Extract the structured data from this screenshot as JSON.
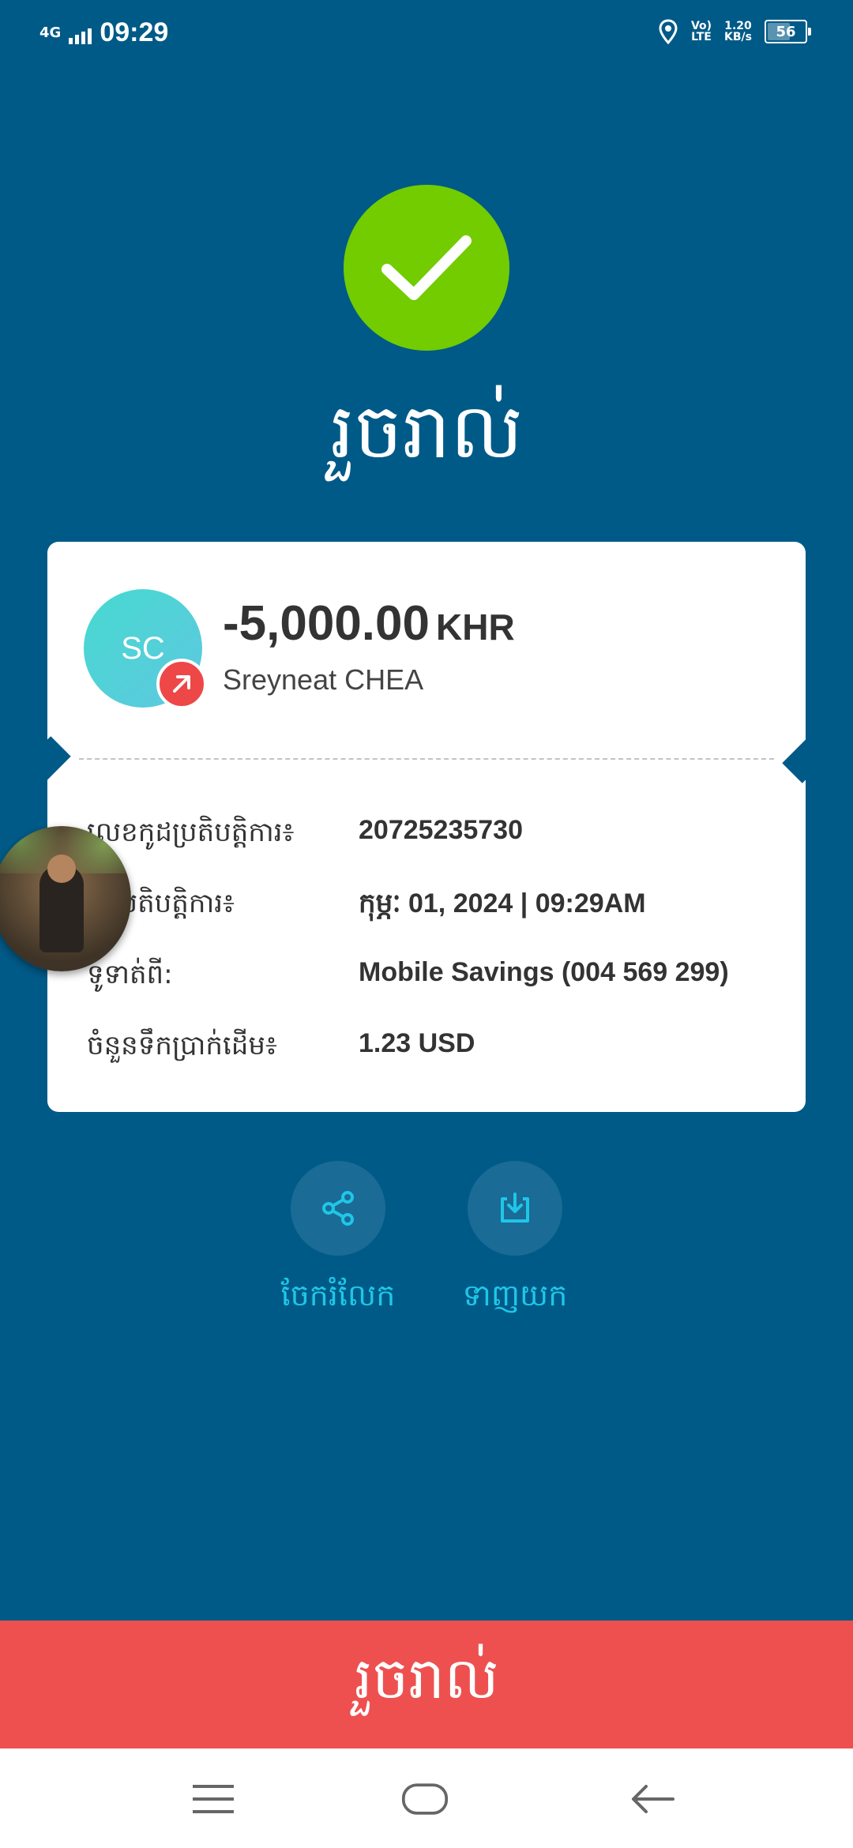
{
  "status_bar": {
    "network": "4G",
    "time": "09:29",
    "volte": "Vo)",
    "lte": "LTE",
    "speed_value": "1.20",
    "speed_unit": "KB/s",
    "battery_level": "56"
  },
  "header": {
    "title": "រួចរាល់"
  },
  "transaction": {
    "avatar_initials": "SC",
    "amount": "-5,000.00",
    "currency": "KHR",
    "payee": "Sreyneat CHEA",
    "details": [
      {
        "label": "លេខកូដប្រតិបត្តិការ៖",
        "value": "20725235730"
      },
      {
        "label": "ថ្ងៃប្រតិបត្តិការ៖",
        "value": "កុម្ភៈ 01, 2024 | 09:29AM"
      },
      {
        "label": "ទូទាត់ពី:",
        "value": "Mobile Savings (004 569 299)"
      },
      {
        "label": "ចំនួនទឹកប្រាក់ដើម៖",
        "value": "1.23 USD"
      }
    ]
  },
  "actions": {
    "share_label": "ចែករំលែក",
    "download_label": "ទាញយក"
  },
  "footer": {
    "done_label": "រួចរាល់"
  },
  "colors": {
    "background": "#005a87",
    "success": "#72cc00",
    "danger": "#ee5050",
    "accent": "#1fc6e8"
  },
  "icons": [
    "check-icon",
    "arrow-up-right-icon",
    "share-icon",
    "download-icon",
    "menu-icon",
    "home-icon",
    "back-icon"
  ]
}
